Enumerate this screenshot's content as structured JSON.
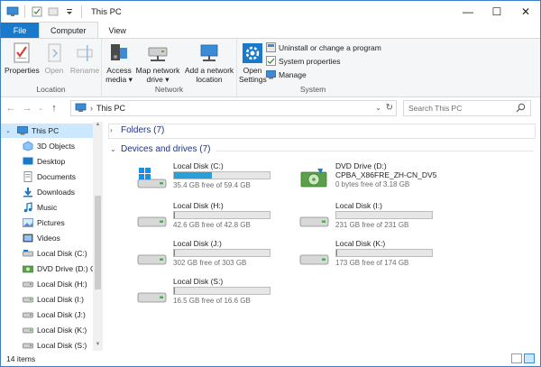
{
  "window": {
    "title": "This PC"
  },
  "window_controls": {
    "minimize": "—",
    "maximize": "☐",
    "close": "✕"
  },
  "ribbon_tabs": [
    "File",
    "Computer",
    "View"
  ],
  "ribbon": {
    "location": {
      "label": "Location",
      "properties": "Properties",
      "open": "Open",
      "rename": "Rename"
    },
    "network": {
      "label": "Network",
      "access_media": [
        "Access",
        "media ▾"
      ],
      "map_drive": [
        "Map network",
        "drive ▾"
      ],
      "add_location": [
        "Add a network",
        "location"
      ]
    },
    "system": {
      "label": "System",
      "open_settings": [
        "Open",
        "Settings"
      ],
      "uninstall": "Uninstall or change a program",
      "system_properties": "System properties",
      "manage": "Manage"
    }
  },
  "address_bar": {
    "path": "This PC",
    "separator": "›"
  },
  "search": {
    "placeholder": "Search This PC"
  },
  "nav_pane": {
    "items": [
      {
        "label": "This PC",
        "icon": "computer-icon"
      },
      {
        "label": "3D Objects",
        "icon": "3d-objects-icon"
      },
      {
        "label": "Desktop",
        "icon": "desktop-icon"
      },
      {
        "label": "Documents",
        "icon": "documents-icon"
      },
      {
        "label": "Downloads",
        "icon": "downloads-icon"
      },
      {
        "label": "Music",
        "icon": "music-icon"
      },
      {
        "label": "Pictures",
        "icon": "pictures-icon"
      },
      {
        "label": "Videos",
        "icon": "videos-icon"
      },
      {
        "label": "Local Disk (C:)",
        "icon": "drive-icon"
      },
      {
        "label": "DVD Drive (D:) C",
        "icon": "dvd-drive-icon"
      },
      {
        "label": "Local Disk (H:)",
        "icon": "drive-icon"
      },
      {
        "label": "Local Disk (I:)",
        "icon": "drive-icon"
      },
      {
        "label": "Local Disk (J:)",
        "icon": "drive-icon"
      },
      {
        "label": "Local Disk (K:)",
        "icon": "drive-icon"
      },
      {
        "label": "Local Disk (S:)",
        "icon": "drive-icon"
      }
    ]
  },
  "content": {
    "folders_header": "Folders (7)",
    "devices_header": "Devices and drives (7)",
    "drives": [
      {
        "name": "Local Disk (C:)",
        "free_text": "35.4 GB free of 59.4 GB",
        "used_fraction": 0.4,
        "icon": "windows-drive-icon"
      },
      {
        "name": "DVD Drive (D:)",
        "name2": "CPBA_X86FRE_ZH-CN_DV5",
        "free_text": "0 bytes free of 3.18 GB",
        "icon": "dvd-drive-icon"
      },
      {
        "name": "Local Disk (H:)",
        "free_text": "42.6 GB free of 42.8 GB",
        "used_fraction": 0.005,
        "icon": "drive-icon"
      },
      {
        "name": "Local Disk (I:)",
        "free_text": "231 GB free of 231 GB",
        "used_fraction": 0.0,
        "icon": "drive-icon"
      },
      {
        "name": "Local Disk (J:)",
        "free_text": "302 GB free of 303 GB",
        "used_fraction": 0.003,
        "icon": "drive-icon"
      },
      {
        "name": "Local Disk (K:)",
        "free_text": "173 GB free of 174 GB",
        "used_fraction": 0.006,
        "icon": "drive-icon"
      },
      {
        "name": "Local Disk (S:)",
        "free_text": "16.5 GB free of 16.6 GB",
        "used_fraction": 0.006,
        "icon": "drive-icon"
      }
    ]
  },
  "status": {
    "items": "14 items"
  },
  "colors": {
    "accent": "#1979ca",
    "bar_fill": "#26a0da",
    "selection": "#cce8ff",
    "section_header": "#1e3287"
  }
}
